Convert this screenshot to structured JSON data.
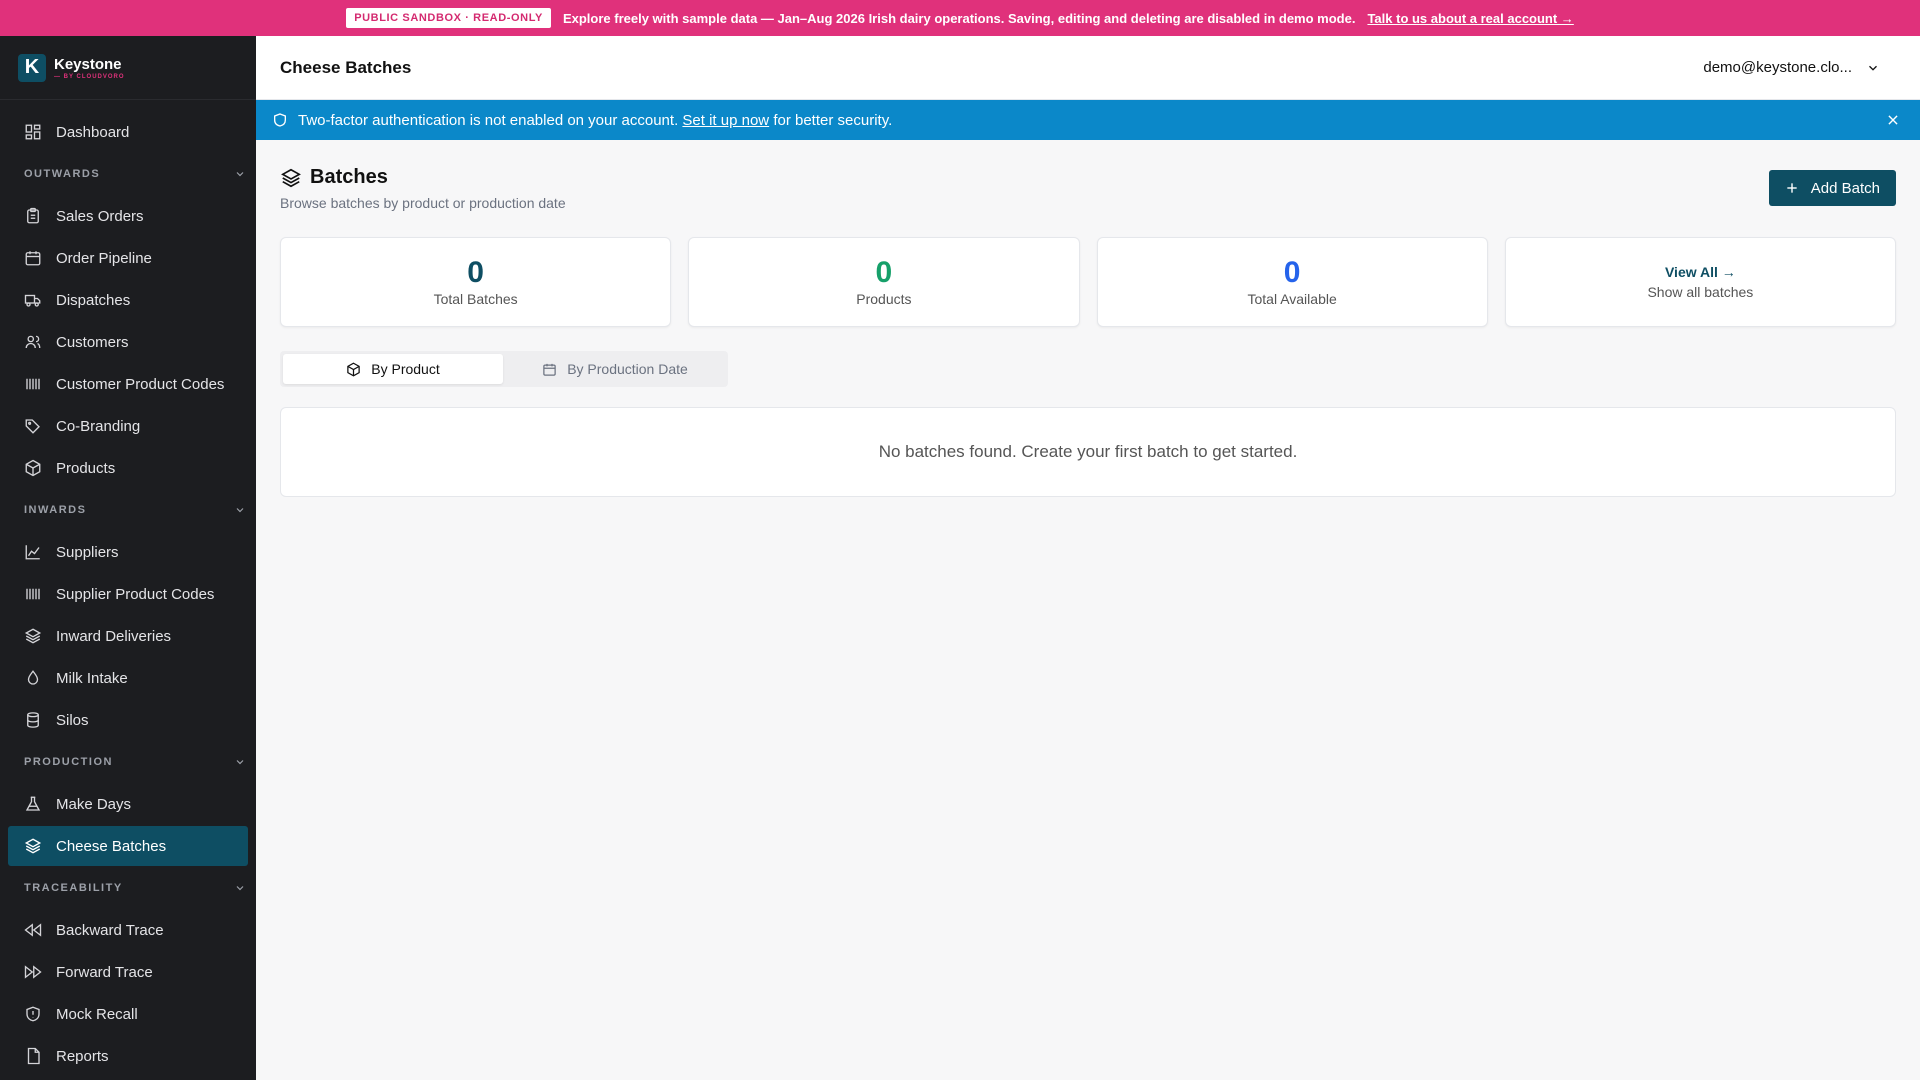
{
  "banner": {
    "badge": "PUBLIC SANDBOX · READ-ONLY",
    "message": "Explore freely with sample data — Jan–Aug 2026 Irish dairy operations. Saving, editing and deleting are disabled in demo mode.",
    "link": "Talk to us about a real account →",
    "color": "#e0317b"
  },
  "brand": {
    "logo_letter": "K",
    "name": "Keystone",
    "sub": "— BY CLOUDVORO"
  },
  "sidebar": {
    "dashboard": "Dashboard",
    "sections": [
      {
        "title": "OUTWARDS",
        "items": [
          {
            "label": "Sales Orders",
            "icon": "clipboard-icon"
          },
          {
            "label": "Order Pipeline",
            "icon": "calendar-icon"
          },
          {
            "label": "Dispatches",
            "icon": "truck-icon"
          },
          {
            "label": "Customers",
            "icon": "users-icon"
          },
          {
            "label": "Customer Product Codes",
            "icon": "barcode-icon"
          },
          {
            "label": "Co-Branding",
            "icon": "tags-icon"
          },
          {
            "label": "Products",
            "icon": "package-icon"
          }
        ]
      },
      {
        "title": "INWARDS",
        "items": [
          {
            "label": "Suppliers",
            "icon": "factory-icon"
          },
          {
            "label": "Supplier Product Codes",
            "icon": "barcode-icon"
          },
          {
            "label": "Inward Deliveries",
            "icon": "package-open-icon"
          },
          {
            "label": "Milk Intake",
            "icon": "droplet-icon"
          },
          {
            "label": "Silos",
            "icon": "cylinder-icon"
          }
        ]
      },
      {
        "title": "PRODUCTION",
        "items": [
          {
            "label": "Make Days",
            "icon": "flask-icon"
          },
          {
            "label": "Cheese Batches",
            "icon": "layers-icon",
            "active": true
          }
        ]
      },
      {
        "title": "TRACEABILITY",
        "items": [
          {
            "label": "Backward Trace",
            "icon": "rewind-icon"
          },
          {
            "label": "Forward Trace",
            "icon": "fast-forward-icon"
          },
          {
            "label": "Mock Recall",
            "icon": "shield-alert-icon"
          },
          {
            "label": "Reports",
            "icon": "file-icon"
          }
        ]
      }
    ]
  },
  "header": {
    "title": "Cheese Batches",
    "user": "demo@keystone.clo..."
  },
  "alert": {
    "text_before": "Two-factor authentication is not enabled on your account.",
    "link": "Set it up now",
    "text_after": "for better security.",
    "color": "#0b88c9"
  },
  "page": {
    "title": "Batches",
    "subtitle": "Browse batches by product or production date",
    "add_button": "Add Batch"
  },
  "stats": [
    {
      "value": "0",
      "label": "Total Batches",
      "color": "#0e4e63"
    },
    {
      "value": "0",
      "label": "Products",
      "color": "#16a06a"
    },
    {
      "value": "0",
      "label": "Total Available",
      "color": "#2563eb"
    }
  ],
  "view_all": {
    "link": "View All →",
    "sub": "Show all batches"
  },
  "tabs": [
    {
      "label": "By Product",
      "icon": "package-icon",
      "active": true
    },
    {
      "label": "By Production Date",
      "icon": "calendar-icon"
    }
  ],
  "empty_message": "No batches found. Create your first batch to get started."
}
